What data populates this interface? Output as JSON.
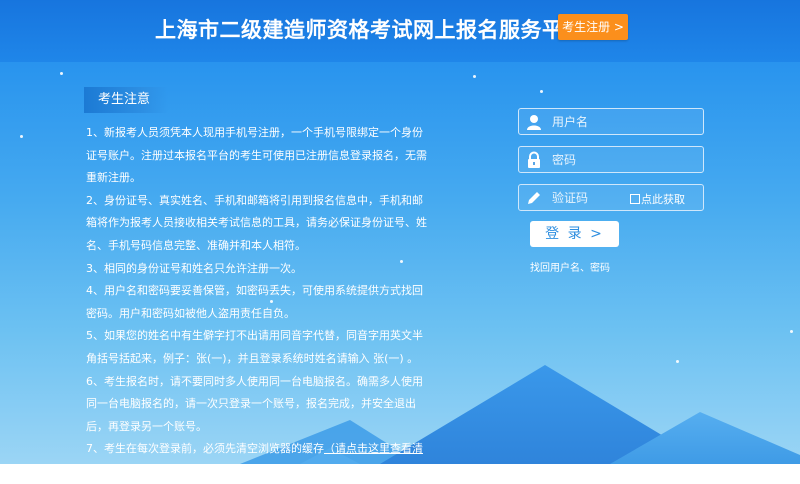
{
  "header": {
    "title": "上海市二级建造师资格考试网上报名服务平台",
    "register_label": "考生注册 >"
  },
  "notice": {
    "heading": "考生注意",
    "items": [
      "1、新报考人员须凭本人现用手机号注册，一个手机号限绑定一个身份证号账户。注册过本报名平台的考生可使用已注册信息登录报名，无需重新注册。",
      "2、身份证号、真实姓名、手机和邮箱将引用到报名信息中，手机和邮箱将作为报考人员接收相关考试信息的工具，请务必保证身份证号、姓名、手机号码信息完整、准确并和本人相符。",
      "3、相同的身份证号和姓名只允许注册一次。",
      "4、用户名和密码要妥善保管，如密码丢失，可使用系统提供方式找回密码。用户和密码如被他人盗用责任自负。",
      "5、如果您的姓名中有生僻字打不出请用同音字代替，同音字用英文半角括号括起来，例子：张(一)，并且登录系统时姓名请输入 张(一) 。",
      "6、考生报名时，请不要同时多人使用同一台电脑报名。确需多人使用同一台电脑报名的，请一次只登录一个账号，报名完成，并安全退出后，再登录另一个账号。"
    ],
    "last_item_prefix": "7、考生在每次登录前，必须先清空浏览器的缓存",
    "last_item_link": "（请点击这里查看清空浏览器缓存的方法）",
    "last_item_suffix": "。"
  },
  "login": {
    "username_placeholder": "用户名",
    "password_placeholder": "密码",
    "captcha_placeholder": "验证码",
    "captcha_image_text": "点此获取",
    "login_label": "登 录 >",
    "recover_label": "找回用户名、密码"
  },
  "colors": {
    "banner": "#1f86e9",
    "register_button": "#fb8f1c",
    "login_button_text": "#2f8fe0"
  },
  "icons": {
    "username": "user-icon",
    "password": "lock-icon",
    "captcha": "pen-icon"
  }
}
